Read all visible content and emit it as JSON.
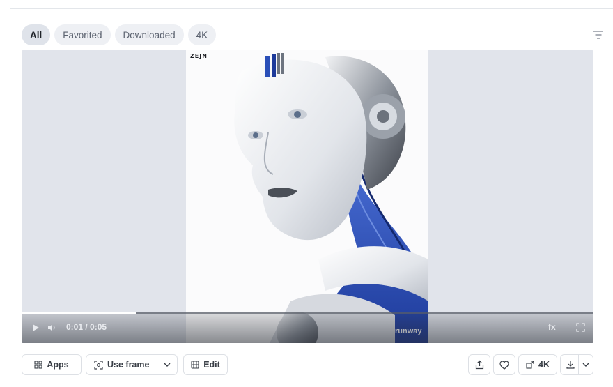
{
  "tabs": [
    {
      "label": "All",
      "active": true
    },
    {
      "label": "Favorited",
      "active": false
    },
    {
      "label": "Downloaded",
      "active": false
    },
    {
      "label": "4K",
      "active": false
    }
  ],
  "video": {
    "brand_mark": "ZEJN",
    "watermark": "runway",
    "time": "0:01 / 0:05",
    "progress": 0.2,
    "fx_label": "fx"
  },
  "toolbar": {
    "apps_label": "Apps",
    "use_frame_label": "Use frame",
    "edit_label": "Edit",
    "resolution_label": "4K"
  },
  "colors": {
    "accent_blue": "#2a4fb8",
    "player_bg": "#e1e4eb"
  }
}
